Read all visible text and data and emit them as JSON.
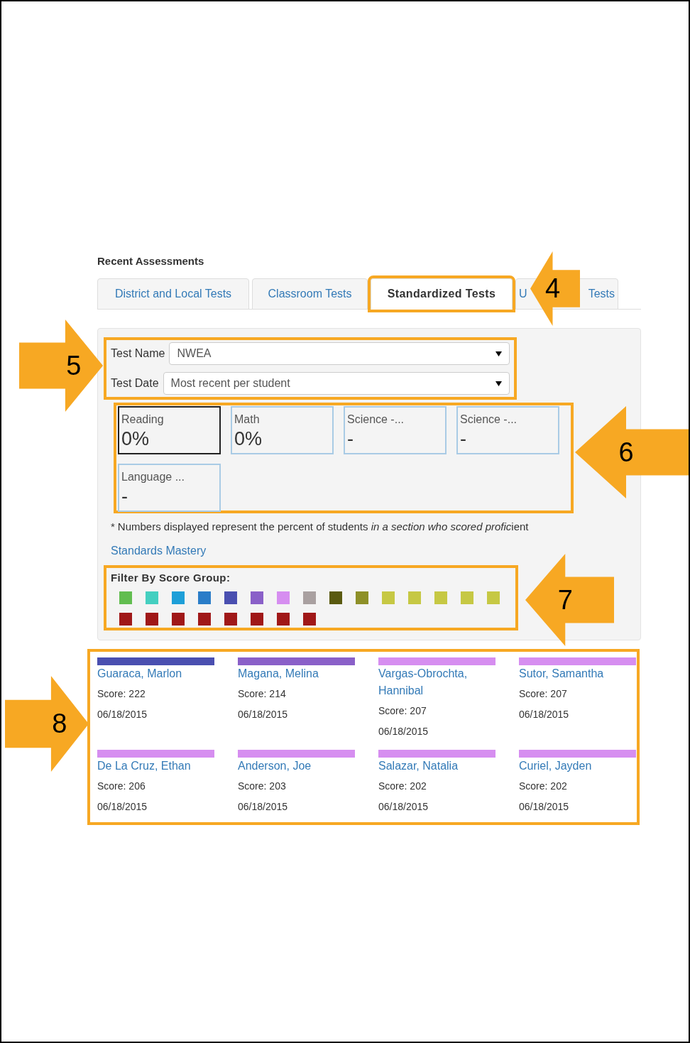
{
  "section_title": "Recent Assessments",
  "tabs": [
    {
      "label": "District and Local Tests",
      "selected": false
    },
    {
      "label": "Classroom Tests",
      "selected": false
    },
    {
      "label": "Standardized Tests",
      "selected": true,
      "highlighted": true
    },
    {
      "label_parts": [
        "U",
        "Tests"
      ],
      "selected": false
    }
  ],
  "filters": [
    {
      "label": "Test Name",
      "value": "NWEA"
    },
    {
      "label": "Test Date",
      "value": "Most recent per student"
    }
  ],
  "score_tiles": [
    {
      "subject": "Reading",
      "value": "0%",
      "selected": true
    },
    {
      "subject": "Math",
      "value": "0%",
      "selected": false
    },
    {
      "subject": "Science -...",
      "value": "-",
      "selected": false
    },
    {
      "subject": "Science -...",
      "value": "-",
      "selected": false
    },
    {
      "subject": "Language ...",
      "value": "-",
      "selected": false
    }
  ],
  "footnote": {
    "marker": "*",
    "parts": [
      {
        "text": "Numbers displayed represent the percent of students ",
        "italic": false
      },
      {
        "text": "in a section who scored profic",
        "italic": true
      },
      {
        "text": "ient",
        "italic": false
      }
    ]
  },
  "standards_link": "Standards Mastery",
  "score_group_filter": {
    "label": "Filter By Score Group:",
    "groups": [
      {
        "color": "#62bd50"
      },
      {
        "color": "#45cfc0"
      },
      {
        "color": "#1e9fd8"
      },
      {
        "color": "#2a7dc8"
      },
      {
        "color": "#4a4fb0"
      },
      {
        "color": "#8a60c8"
      },
      {
        "color": "#d68ef0"
      },
      {
        "color": "#a9a0a0"
      },
      {
        "color": "#5a5a10"
      },
      {
        "color": "#8e9028"
      },
      {
        "color": "#c6c844"
      },
      {
        "color": "#c6c844"
      },
      {
        "color": "#c6c844"
      },
      {
        "color": "#c6c844"
      },
      {
        "color": "#c6c844"
      },
      {
        "color": "#a01818"
      },
      {
        "color": "#a01818"
      },
      {
        "color": "#a01818"
      },
      {
        "color": "#a01818"
      },
      {
        "color": "#a01818"
      },
      {
        "color": "#a01818"
      },
      {
        "color": "#a01818"
      },
      {
        "color": "#a01818"
      }
    ]
  },
  "students": [
    {
      "name": "Guaraca, Marlon",
      "score": "Score: 222",
      "date": "06/18/2015",
      "color": "#4a4fb0"
    },
    {
      "name": "Magana, Melina",
      "score": "Score: 214",
      "date": "06/18/2015",
      "color": "#8a60c8"
    },
    {
      "name": "Vargas-Obrochta, Hannibal",
      "score": "Score: 207",
      "date": "06/18/2015",
      "color": "#d68ef0"
    },
    {
      "name": "Sutor, Samantha",
      "score": "Score: 207",
      "date": "06/18/2015",
      "color": "#d68ef0"
    },
    {
      "name": "De La Cruz, Ethan",
      "score": "Score: 206",
      "date": "06/18/2015",
      "color": "#d68ef0"
    },
    {
      "name": "Anderson, Joe",
      "score": "Score: 203",
      "date": "06/18/2015",
      "color": "#d68ef0"
    },
    {
      "name": "Salazar, Natalia",
      "score": "Score: 202",
      "date": "06/18/2015",
      "color": "#d68ef0"
    },
    {
      "name": "Curiel, Jayden",
      "score": "Score: 202",
      "date": "06/18/2015",
      "color": "#d68ef0"
    }
  ],
  "callouts": [
    {
      "number": "4",
      "kind": "left"
    },
    {
      "number": "5",
      "kind": "right"
    },
    {
      "number": "6",
      "kind": "left"
    },
    {
      "number": "7",
      "kind": "left"
    },
    {
      "number": "8",
      "kind": "right"
    }
  ]
}
